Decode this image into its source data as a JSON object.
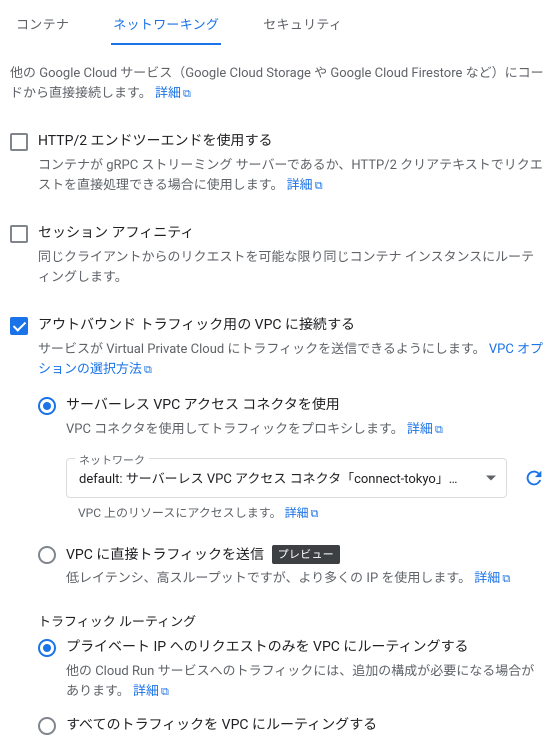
{
  "tabs": {
    "container": "コンテナ",
    "networking": "ネットワーキング",
    "security": "セキュリティ"
  },
  "intro": {
    "text_a": "他の Google Cloud サービス（Google Cloud Storage や Google Cloud Firestore など）にコードから直接接続します。 ",
    "learn_more": "詳細"
  },
  "http2": {
    "title": "HTTP/2 エンドツーエンドを使用する",
    "desc_a": "コンテナが gRPC ストリーミング サーバーであるか、HTTP/2 クリアテキストでリクエストを直接処理できる場合に使用します。 ",
    "learn_more": "詳細"
  },
  "affinity": {
    "title": "セッション アフィニティ",
    "desc": "同じクライアントからのリクエストを可能な限り同じコンテナ インスタンスにルーティングします。"
  },
  "vpc": {
    "title": "アウトバウンド トラフィック用の VPC に接続する",
    "desc_a": "サービスが Virtual Private Cloud にトラフィックを送信できるようにします。 ",
    "options_link": "VPC オプションの選択方法",
    "conn": {
      "title": "サーバーレス VPC アクセス コネクタを使用",
      "desc_a": "VPC コネクタを使用してトラフィックをプロキシします。 ",
      "learn_more": "詳細",
      "field_label": "ネットワーク",
      "field_value": "default: サーバーレス VPC アクセス コネクタ「connect-tokyo」…",
      "field_help_a": "VPC 上のリソースにアクセスします。 ",
      "field_help_link": "詳細"
    },
    "direct": {
      "title": "VPC に直接トラフィックを送信",
      "badge": "プレビュー",
      "desc_a": "低レイテンシ、高スループットですが、より多くの IP を使用します。 ",
      "learn_more": "詳細"
    },
    "routing": {
      "heading": "トラフィック ルーティング",
      "private": {
        "title": "プライベート IP へのリクエストのみを VPC にルーティングする",
        "desc_a": "他の Cloud Run サービスへのトラフィックには、追加の構成が必要になる場合があります。 ",
        "learn_more": "詳細"
      },
      "all": {
        "title": "すべてのトラフィックを VPC にルーティングする"
      }
    }
  }
}
